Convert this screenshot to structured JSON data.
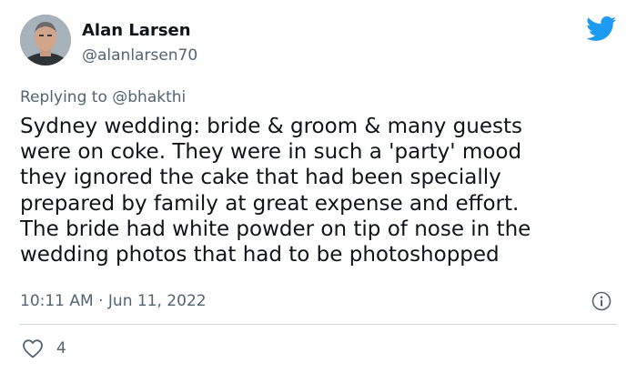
{
  "author": {
    "name": "Alan Larsen",
    "handle": "@alanlarsen70"
  },
  "reply": {
    "prefix": "Replying to ",
    "handle": "@bhakthi"
  },
  "tweet": {
    "lines": [
      "Sydney wedding: bride & groom & many guests",
      "were on coke. They were in such a 'party' mood",
      "they ignored the cake that had been specially",
      "prepared by family at great expense and effort.",
      "The bride had white powder on tip of nose in the",
      "wedding photos that had to be photoshopped"
    ]
  },
  "meta": {
    "timestamp": "10:11 AM · Jun 11, 2022"
  },
  "actions": {
    "like_count": "4"
  },
  "icons": {
    "brand": "twitter-bird-icon",
    "info": "info-icon",
    "like": "heart-icon"
  },
  "colors": {
    "brand": "#1d9bf0",
    "text_primary": "#0f1419",
    "text_secondary": "#536471",
    "divider": "#cfd9de"
  }
}
